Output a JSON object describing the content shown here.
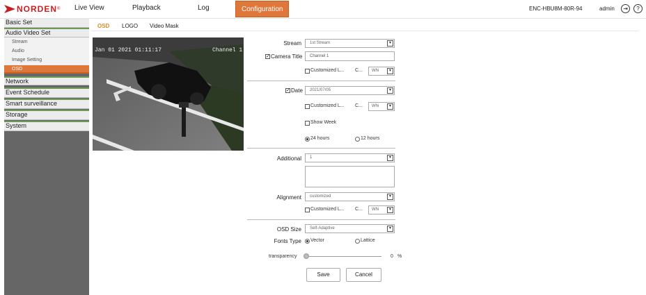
{
  "header": {
    "brand": "NORDEN",
    "brand_mark": "®",
    "nav": [
      "Live View",
      "Playback",
      "Log",
      "Configuration"
    ],
    "active_nav": "Configuration",
    "device_name": "ENC-HBU8M-80R-94",
    "user": "admin",
    "brand_color": "#c81e1e",
    "accent_color": "#e0773a"
  },
  "sidebar": {
    "sections": [
      "Basic Set",
      "Audio Video Set",
      "Network",
      "Event Schedule",
      "Smart surveillance",
      "Storage",
      "System"
    ],
    "sub_items": [
      "Stream",
      "Audio",
      "Image Setting",
      "OSD"
    ],
    "active_sub": "OSD"
  },
  "tabs": [
    "OSD",
    "LOGO",
    "Video Mask"
  ],
  "active_tab": "OSD",
  "preview": {
    "datetime_overlay": "Jan 01 2021 01:11:17",
    "channel_overlay": "Channel 1"
  },
  "form": {
    "stream_label": "Stream",
    "stream_value": "1st Stream",
    "camera_title_label": "Camera Title",
    "camera_title_value": "Channel 1",
    "camera_title_checked": true,
    "customized_label": "Customized L...",
    "color_label": "C...",
    "color_value": "Whi",
    "date_label": "Date",
    "date_checked": true,
    "date_value": "2021/07/05",
    "show_week_label": "Show Week",
    "hour24_label": "24 hours",
    "hour12_label": "12 hours",
    "additional_label": "Additional",
    "additional_value": "1",
    "alignment_label": "Alignment",
    "alignment_value": "customized",
    "osd_size_label": "OSD Size",
    "osd_size_value": "Self-Adaptive",
    "fonts_type_label": "Fonts Type",
    "font_vector": "Vector",
    "font_lattice": "Lattice",
    "transparency_label": "transparency",
    "transparency_value": "0",
    "transparency_unit": "%",
    "save_label": "Save",
    "cancel_label": "Cancel"
  },
  "icons": [
    "logout-icon",
    "help-icon",
    "dropdown-arrow-icon",
    "norden-logo-icon"
  ]
}
